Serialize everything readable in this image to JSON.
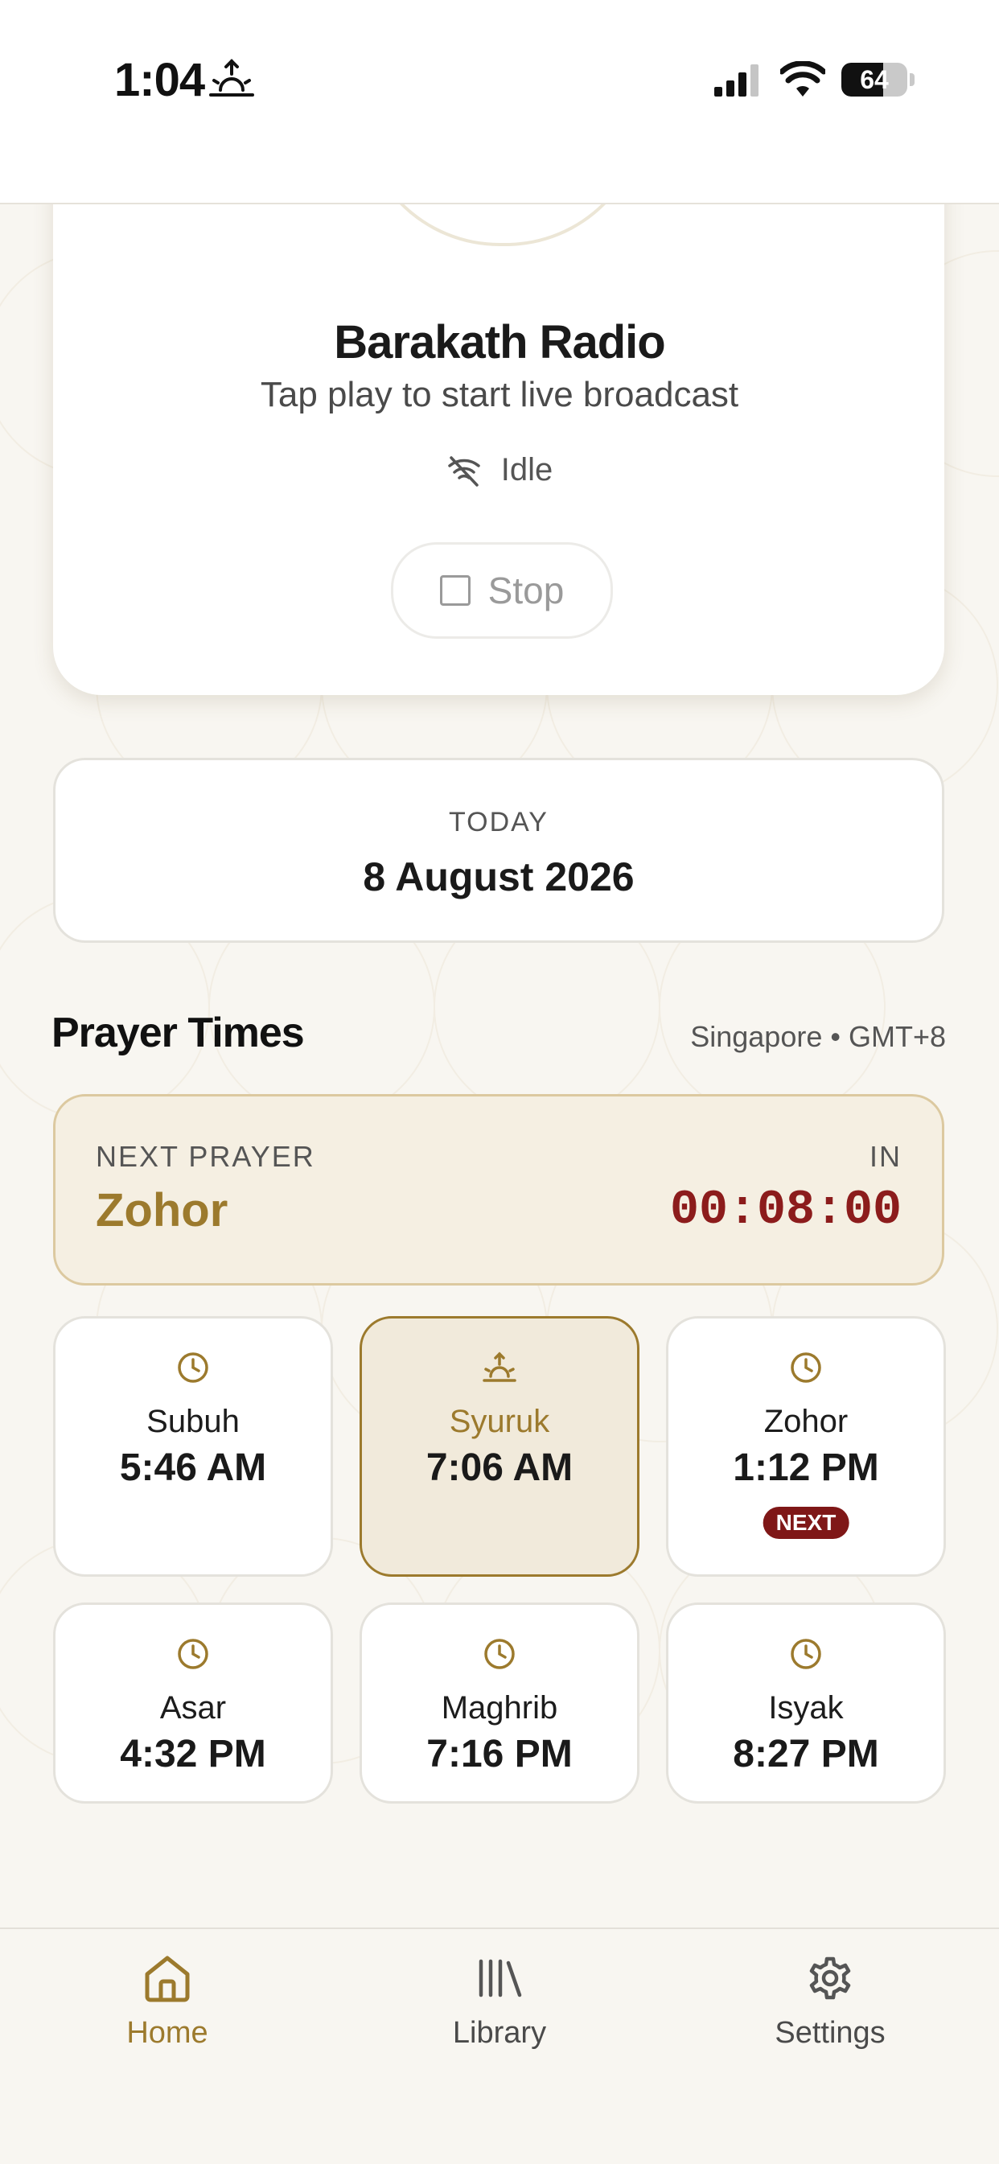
{
  "status_bar": {
    "time": "1:04",
    "battery": "64",
    "battery_level": 0.64
  },
  "radio": {
    "title": "Barakath Radio",
    "subtitle": "Tap play to start live broadcast",
    "status": "Idle",
    "stop_label": "Stop"
  },
  "date_card": {
    "caption": "TODAY",
    "date": "8 August 2026"
  },
  "prayer": {
    "heading": "Prayer Times",
    "location": "Singapore • GMT+8",
    "next": {
      "caption": "NEXT PRAYER",
      "name": "Zohor",
      "in_label": "IN",
      "countdown": "00:08:00"
    },
    "times": [
      {
        "name": "Subuh",
        "time": "5:46 AM",
        "icon": "clock-icon"
      },
      {
        "name": "Syuruk",
        "time": "7:06 AM",
        "icon": "sunrise-icon",
        "active": true
      },
      {
        "name": "Zohor",
        "time": "1:12 PM",
        "icon": "clock-icon",
        "badge": "NEXT"
      },
      {
        "name": "Asar",
        "time": "4:32 PM",
        "icon": "clock-icon"
      },
      {
        "name": "Maghrib",
        "time": "7:16 PM",
        "icon": "clock-icon"
      },
      {
        "name": "Isyak",
        "time": "8:27 PM",
        "icon": "clock-icon"
      }
    ]
  },
  "nav": {
    "items": [
      {
        "label": "Home",
        "icon": "home-icon",
        "active": true
      },
      {
        "label": "Library",
        "icon": "library-icon"
      },
      {
        "label": "Settings",
        "icon": "gear-icon"
      }
    ]
  },
  "colors": {
    "accent": "#9c7a2d",
    "countdown": "#8c1c1c",
    "badge": "#7f1717"
  }
}
